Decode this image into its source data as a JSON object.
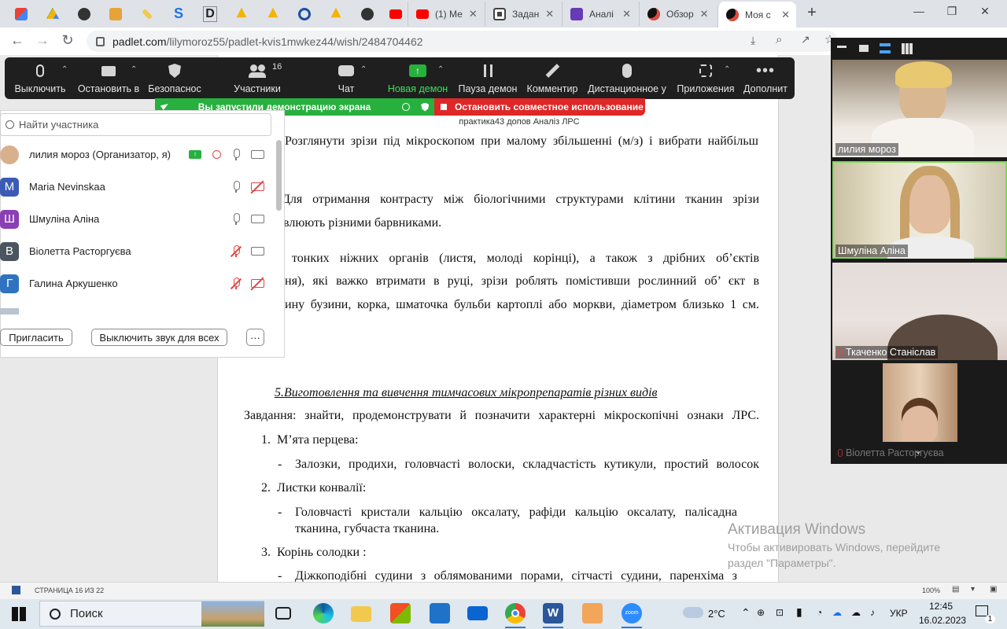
{
  "browser": {
    "tabs": [
      {
        "label": "",
        "icon": "gmail-icon"
      },
      {
        "label": "",
        "icon": "google-drive-icon"
      },
      {
        "label": "",
        "icon": "globe-icon"
      },
      {
        "label": "",
        "icon": "broom-icon"
      },
      {
        "label": "",
        "icon": "pencil-icon"
      },
      {
        "label": "",
        "icon": "s-logo-icon"
      },
      {
        "label": "",
        "icon": "d-logo-icon"
      },
      {
        "label": "",
        "icon": "bell-icon"
      },
      {
        "label": "",
        "icon": "bell-icon"
      },
      {
        "label": "",
        "icon": "ring-icon"
      },
      {
        "label": "",
        "icon": "bell-icon"
      },
      {
        "label": "",
        "icon": "globe-icon"
      },
      {
        "label": "",
        "icon": "youtube-icon"
      },
      {
        "label": "(1) Ме",
        "icon": "youtube-icon"
      },
      {
        "label": "Задан",
        "icon": "classroom-icon"
      },
      {
        "label": "Аналі",
        "icon": "forms-icon"
      },
      {
        "label": "Обзор",
        "icon": "padlet-icon"
      },
      {
        "label": "Моя с",
        "icon": "padlet-icon",
        "active": true
      }
    ],
    "new_tab": "+",
    "url_host": "padlet.com",
    "url_path": "/lilymoroz55/padlet-kvis1mwkez44/wish/2484704462"
  },
  "zoom_toolbar": {
    "buttons": [
      {
        "label": "Выключить",
        "icon": "mic-icon"
      },
      {
        "label": "Остановить в",
        "icon": "video-camera-icon"
      },
      {
        "label": "Безопаснос",
        "icon": "shield-icon"
      },
      {
        "label": "Участники",
        "icon": "participants-icon",
        "count": "16"
      },
      {
        "label": "Чат",
        "icon": "chat-icon"
      },
      {
        "label": "Новая демон",
        "icon": "share-screen-icon"
      },
      {
        "label": "Пауза демон",
        "icon": "pause-icon"
      },
      {
        "label": "Комментир",
        "icon": "annotate-pen-icon"
      },
      {
        "label": "Дистанционное у",
        "icon": "mouse-icon"
      },
      {
        "label": "Приложения",
        "icon": "apps-icon"
      },
      {
        "label": "Дополнит",
        "icon": "more-icon"
      }
    ],
    "share_banner": "Вы запустили демонстрацию экрана",
    "stop_share": "Остановить совместное использование",
    "meeting_name": "практика43 допов Аналіз ЛРС"
  },
  "participants": {
    "search_placeholder": "Найти участника",
    "list": [
      {
        "name": "лилия мороз (Организатор, я)",
        "initial": "",
        "color": "#c9a27a",
        "mic": "on",
        "cam": "on"
      },
      {
        "name": "Maria Nevinskaa",
        "initial": "M",
        "color": "#3b5bb5",
        "mic": "on",
        "cam": "off"
      },
      {
        "name": "Шмуліна Аліна",
        "initial": "Ш",
        "color": "#8a3fb5",
        "mic": "on",
        "cam": "on"
      },
      {
        "name": "Віолетта Расторгуєва",
        "initial": "В",
        "color": "#4a5560",
        "mic": "off",
        "cam": "on"
      },
      {
        "name": "Галина Аркушенко",
        "initial": "Г",
        "color": "#2f72c0",
        "mic": "off",
        "cam": "off"
      }
    ],
    "invite_button": "Пригласить",
    "mute_all_button": "Выключить звук для всех",
    "more_button": "···"
  },
  "document": {
    "lines": [
      "Розглянути зрізи під мікроскопом при малому збільшенні (м/з) і вибрати найбільш",
      "Для отримання контрасту між біологічними структурами клітини тканин зрізи",
      "влюють різними барвниками.",
      "тонких ніжних органів (листя, молоді корінці), а також з дрібних об’єктів",
      "ня), які важко втримати в руці, зрізи роблять помістивши рослинний об’ єкт в",
      "ину бузини, корка, шматочка бульби картоплі або моркви, діаметром близько 1 см.",
      "5.Виготовлення та вивчення тимчасових мікропрепаратів різних видів",
      "Завдання: знайти, продемонструвати й позначити характерні мікроскопічні ознаки ЛРС.",
      "1.",
      "М’ята перцева:",
      "-",
      "Залозки, продихи, головчасті волоски, складчастість кутикули, простий волосок",
      "2.",
      "Листки конвалії:",
      "-",
      "Головчасті кристали кальцію оксалату, рафіди кальцію оксалату, палісадна",
      "тканина, губчаста тканина.",
      "3.",
      "Корінь солодки :",
      "-",
      "Діжкоподібні  судини з облямованими порами, сітчасті судини, паренхіма з"
    ]
  },
  "videos": [
    {
      "name": "лилия мороз",
      "muted": false
    },
    {
      "name": "Шмуліна Аліна",
      "muted": false
    },
    {
      "name": "Ткаченко Станіслав",
      "muted": true
    },
    {
      "name": "Віолетта Расторгуєва",
      "muted": true
    }
  ],
  "watermark": {
    "title": "Активация Windows",
    "line1": "Чтобы активировать Windows, перейдите",
    "line2": "раздел \"Параметры\"."
  },
  "word_status": {
    "page": "СТРАНИЦА 16 ИЗ 22",
    "zoom": "100%"
  },
  "taskbar": {
    "search_placeholder": "Поиск",
    "weather": "2°C",
    "language": "УКР",
    "time": "12:45",
    "date": "16.02.2023",
    "notifications": "1"
  }
}
